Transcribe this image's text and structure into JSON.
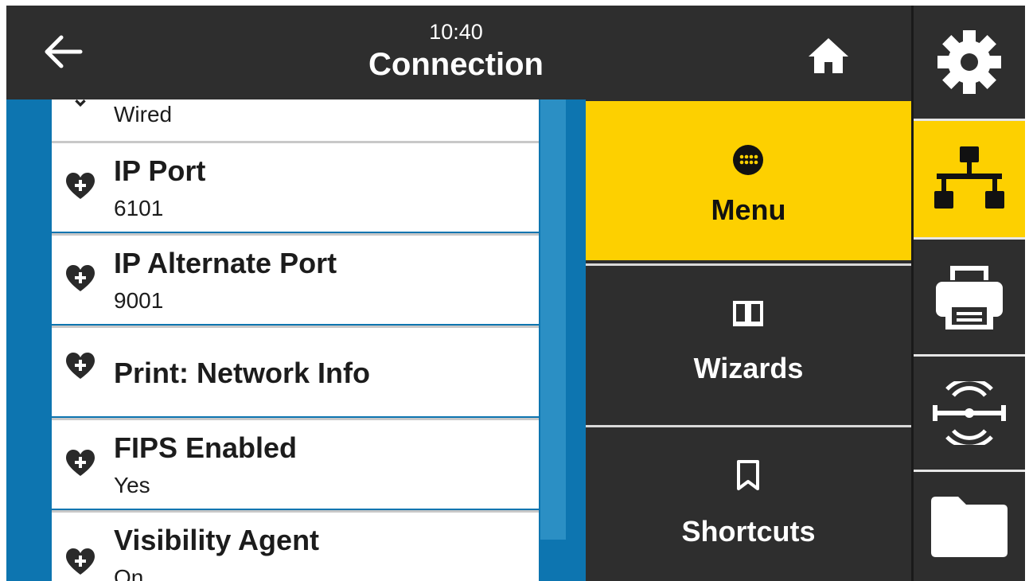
{
  "header": {
    "time": "10:40",
    "title": "Connection",
    "back_icon": "arrow-left-icon",
    "home_icon": "home-icon"
  },
  "list": {
    "items": [
      {
        "label": "",
        "value": "Wired",
        "partial": true
      },
      {
        "label": "IP Port",
        "value": "6101"
      },
      {
        "label": "IP Alternate Port",
        "value": "9001"
      },
      {
        "label": "Print: Network Info",
        "value": ""
      },
      {
        "label": "FIPS Enabled",
        "value": "Yes"
      },
      {
        "label": "Visibility Agent",
        "value": "On"
      }
    ],
    "item_icon": "heart-plus-icon"
  },
  "menu": {
    "items": [
      {
        "label": "Menu",
        "icon": "menu-grid-icon",
        "active": true
      },
      {
        "label": "Wizards",
        "icon": "book-icon",
        "active": false
      },
      {
        "label": "Shortcuts",
        "icon": "bookmark-icon",
        "active": false
      }
    ]
  },
  "sidebar": {
    "items": [
      {
        "icon": "gear-icon",
        "active": false
      },
      {
        "icon": "network-icon",
        "active": true
      },
      {
        "icon": "printer-icon",
        "active": false
      },
      {
        "icon": "rfid-icon",
        "active": false
      },
      {
        "icon": "folder-icon",
        "active": false
      }
    ]
  },
  "colors": {
    "accent": "#fdd000",
    "panel_blue": "#0d75b0",
    "dark": "#2e2e2e"
  }
}
